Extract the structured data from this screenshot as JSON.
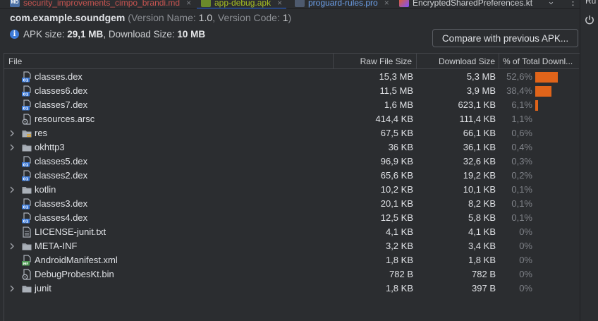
{
  "tabs": [
    {
      "label": "security_improvements_cimpo_brandi.md",
      "icon": "markdown-icon",
      "color": "#c75450",
      "active": false
    },
    {
      "label": "app-debug.apk",
      "icon": "apk-file-icon",
      "color": "#a8c023",
      "active": true
    },
    {
      "label": "proguard-rules.pro",
      "icon": "text-file-icon",
      "color": "#6c9fe8",
      "active": false
    },
    {
      "label": "EncryptedSharedPreferences.kt",
      "icon": "kotlin-file-icon",
      "color": "#cfd1d4",
      "active": false
    }
  ],
  "tool_window_label": "Ru",
  "header": {
    "package_name": "com.example.soundgem",
    "version_prefix": "(Version Name: ",
    "version_name": "1.0",
    "version_mid": ", Version Code: ",
    "version_code": "1",
    "version_suffix": ")",
    "apk_size_label": "APK size: ",
    "apk_size": "29,1 MB",
    "download_size_label": ", Download Size: ",
    "download_size": "10 MB",
    "compare_button": "Compare with previous APK..."
  },
  "table": {
    "columns": {
      "file": "File",
      "raw": "Raw File Size",
      "download": "Download Size",
      "percent": "% of Total Downl..."
    },
    "rows": [
      {
        "name": "classes.dex",
        "icon": "dex-icon",
        "expandable": false,
        "raw": "15,3 MB",
        "download": "5,3 MB",
        "percent": "52,6%",
        "share": 0.526
      },
      {
        "name": "classes6.dex",
        "icon": "dex-icon",
        "expandable": false,
        "raw": "11,5 MB",
        "download": "3,9 MB",
        "percent": "38,4%",
        "share": 0.384
      },
      {
        "name": "classes7.dex",
        "icon": "dex-icon",
        "expandable": false,
        "raw": "1,6 MB",
        "download": "623,1 KB",
        "percent": "6,1%",
        "share": 0.061
      },
      {
        "name": "resources.arsc",
        "icon": "arsc-file-icon",
        "expandable": false,
        "raw": "414,4 KB",
        "download": "111,4 KB",
        "percent": "1,1%",
        "share": 0.011
      },
      {
        "name": "res",
        "icon": "resource-folder-icon",
        "expandable": true,
        "raw": "67,5 KB",
        "download": "66,1 KB",
        "percent": "0,6%",
        "share": 0.006
      },
      {
        "name": "okhttp3",
        "icon": "folder-icon",
        "expandable": true,
        "raw": "36 KB",
        "download": "36,1 KB",
        "percent": "0,4%",
        "share": 0.004
      },
      {
        "name": "classes5.dex",
        "icon": "dex-icon",
        "expandable": false,
        "raw": "96,9 KB",
        "download": "32,6 KB",
        "percent": "0,3%",
        "share": 0.003
      },
      {
        "name": "classes2.dex",
        "icon": "dex-icon",
        "expandable": false,
        "raw": "65,6 KB",
        "download": "19,2 KB",
        "percent": "0,2%",
        "share": 0.002
      },
      {
        "name": "kotlin",
        "icon": "folder-icon",
        "expandable": true,
        "raw": "10,2 KB",
        "download": "10,1 KB",
        "percent": "0,1%",
        "share": 0.001
      },
      {
        "name": "classes3.dex",
        "icon": "dex-icon",
        "expandable": false,
        "raw": "20,1 KB",
        "download": "8,2 KB",
        "percent": "0,1%",
        "share": 0.001
      },
      {
        "name": "classes4.dex",
        "icon": "dex-icon",
        "expandable": false,
        "raw": "12,5 KB",
        "download": "5,8 KB",
        "percent": "0,1%",
        "share": 0.001
      },
      {
        "name": "LICENSE-junit.txt",
        "icon": "text-file-icon",
        "expandable": false,
        "raw": "4,1 KB",
        "download": "4,1 KB",
        "percent": "0%",
        "share": 0
      },
      {
        "name": "META-INF",
        "icon": "folder-icon",
        "expandable": true,
        "raw": "3,2 KB",
        "download": "3,4 KB",
        "percent": "0%",
        "share": 0
      },
      {
        "name": "AndroidManifest.xml",
        "icon": "manifest-icon",
        "expandable": false,
        "raw": "1,8 KB",
        "download": "1,8 KB",
        "percent": "0%",
        "share": 0
      },
      {
        "name": "DebugProbesKt.bin",
        "icon": "binary-file-icon",
        "expandable": false,
        "raw": "782 B",
        "download": "782 B",
        "percent": "0%",
        "share": 0
      },
      {
        "name": "junit",
        "icon": "folder-icon",
        "expandable": true,
        "raw": "1,8 KB",
        "download": "397 B",
        "percent": "0%",
        "share": 0
      }
    ]
  },
  "colors": {
    "background": "#2b2d30",
    "bar": "#e0641a",
    "accent": "#3574f0"
  }
}
